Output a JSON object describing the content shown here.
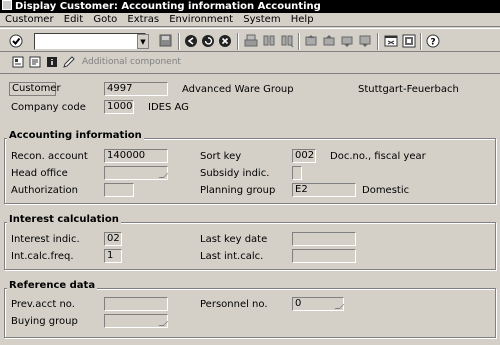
{
  "title_bar": {
    "text": "Display Customer: Accounting information Accounting"
  },
  "menu": [
    "Customer",
    "Edit",
    "Goto",
    "Extras",
    "Environment",
    "System",
    "Help"
  ],
  "toolbar": {
    "command_field": ""
  },
  "app_toolbar": {
    "additional_component": "Additional component"
  },
  "header": {
    "customer_label": "Customer",
    "customer_value": "4997",
    "customer_name": "Advanced Ware Group",
    "city": "Stuttgart-Feuerbach",
    "company_code_label": "Company code",
    "company_code_value": "1000",
    "company_name": "IDES AG"
  },
  "accounting": {
    "title": "Accounting information",
    "recon_label": "Recon. account",
    "recon_value": "140000",
    "head_office_label": "Head office",
    "head_office_value": "",
    "authorization_label": "Authorization",
    "authorization_value": "",
    "sort_key_label": "Sort key",
    "sort_key_value": "002",
    "sort_key_desc": "Doc.no., fiscal year",
    "subsidy_label": "Subsidy indic.",
    "subsidy_value": "",
    "planning_group_label": "Planning group",
    "planning_group_value": "E2",
    "planning_group_desc": "Domestic"
  },
  "interest": {
    "title": "Interest calculation",
    "indic_label": "Interest indic.",
    "indic_value": "02",
    "freq_label": "Int.calc.freq.",
    "freq_value": "1",
    "last_key_date_label": "Last key date",
    "last_key_date_value": "",
    "last_int_calc_label": "Last int.calc.",
    "last_int_calc_value": ""
  },
  "reference": {
    "title": "Reference data",
    "prev_acct_label": "Prev.acct no.",
    "prev_acct_value": "",
    "personnel_label": "Personnel no.",
    "personnel_value": "0",
    "buying_group_label": "Buying group",
    "buying_group_value": ""
  }
}
